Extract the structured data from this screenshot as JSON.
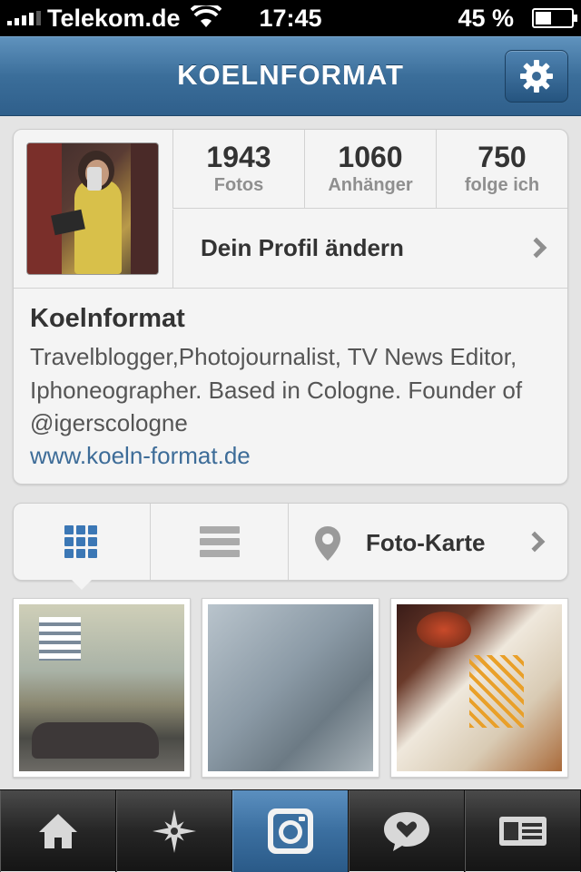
{
  "status_bar": {
    "carrier": "Telekom.de",
    "time": "17:45",
    "battery": "45 %",
    "battery_level": 0.45,
    "icons": [
      "signal-icon",
      "wifi-icon",
      "battery-icon"
    ]
  },
  "header": {
    "title": "KOELNFORMAT",
    "settings_icon": "gear-icon"
  },
  "profile": {
    "stats": [
      {
        "value": "1943",
        "label": "Fotos"
      },
      {
        "value": "1060",
        "label": "Anhänger"
      },
      {
        "value": "750",
        "label": "folge ich"
      }
    ],
    "edit_label": "Dein Profil ändern",
    "name": "Koelnformat",
    "bio": "Travelblogger,Photojournalist, TV News Editor, Iphoneographer. Based in Cologne. Founder of @igerscologne",
    "website": "www.koeln-format.de"
  },
  "view_switcher": {
    "grid_icon": "grid-view-icon",
    "list_icon": "list-view-icon",
    "map_icon": "map-pin-icon",
    "map_label": "Foto-Karte",
    "selected": "grid"
  },
  "photos": [
    "photo-1",
    "photo-2",
    "photo-3"
  ],
  "tab_bar": {
    "tabs": [
      "home-icon",
      "explore-icon",
      "camera-icon",
      "news-icon",
      "profile-icon"
    ],
    "active": 2
  },
  "colors": {
    "nav_blue": "#3b6e9a",
    "link_blue": "#3d6c98",
    "grid_icon_blue": "#3b77b5",
    "background": "#e4e4e4"
  }
}
